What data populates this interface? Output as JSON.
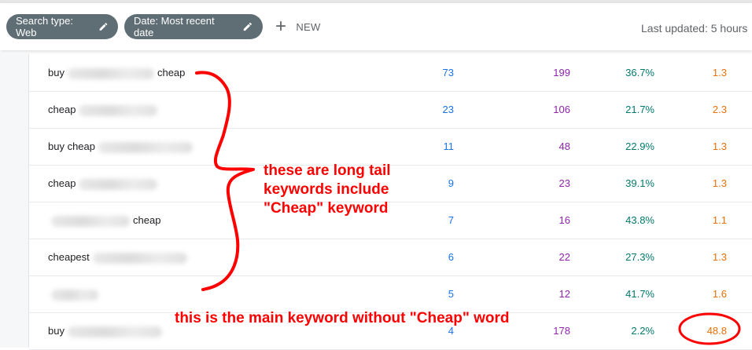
{
  "toolbar": {
    "filters": [
      {
        "label": "Search type: Web"
      },
      {
        "label": "Date: Most recent date"
      }
    ],
    "new_label": "NEW",
    "last_updated": "Last updated: 5 hours"
  },
  "colors": {
    "clicks": "#1a73e8",
    "impressions": "#8e24aa",
    "ctr": "#00796b",
    "position": "#e8710a",
    "annotation": "#ff0000",
    "chip": "#5f6d75"
  },
  "rows": [
    {
      "query_start": "buy",
      "query_end": "cheap",
      "clicks": "73",
      "impressions": "199",
      "ctr": "36.7%",
      "position": "1.3"
    },
    {
      "query_start": "cheap",
      "query_end": "",
      "clicks": "23",
      "impressions": "106",
      "ctr": "21.7%",
      "position": "2.3"
    },
    {
      "query_start": "buy cheap",
      "query_end": "",
      "clicks": "11",
      "impressions": "48",
      "ctr": "22.9%",
      "position": "1.3"
    },
    {
      "query_start": "cheap",
      "query_end": "",
      "clicks": "9",
      "impressions": "23",
      "ctr": "39.1%",
      "position": "1.3"
    },
    {
      "query_start": "",
      "query_end": "cheap",
      "clicks": "7",
      "impressions": "16",
      "ctr": "43.8%",
      "position": "1.1"
    },
    {
      "query_start": "cheapest",
      "query_end": "",
      "clicks": "6",
      "impressions": "22",
      "ctr": "27.3%",
      "position": "1.3"
    },
    {
      "query_start": "",
      "query_end": "",
      "clicks": "5",
      "impressions": "12",
      "ctr": "41.7%",
      "position": "1.6"
    },
    {
      "query_start": "buy",
      "query_end": "",
      "clicks": "4",
      "impressions": "178",
      "ctr": "2.2%",
      "position": "48.8"
    }
  ],
  "annotations": {
    "long_tail_note": [
      "these are long tail",
      "keywords include",
      "\"Cheap\" keyword"
    ],
    "main_keyword_note": "this is the main keyword without \"Cheap\" word"
  }
}
